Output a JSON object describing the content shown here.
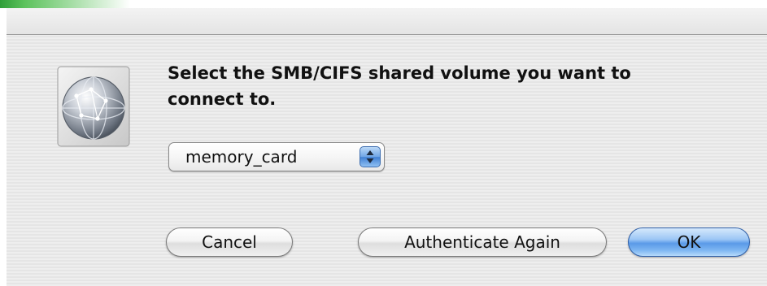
{
  "dialog": {
    "message": "Select the SMB/CIFS shared volume you want to connect to.",
    "app_icon": "network-globe-icon"
  },
  "volume_select": {
    "selected": "memory_card",
    "arrows_icon": "updown-arrows-icon"
  },
  "buttons": {
    "cancel": "Cancel",
    "authenticate": "Authenticate Again",
    "ok": "OK"
  },
  "colors": {
    "default_button": "#6fa6e6",
    "window_background": "#ebebeb",
    "top_strip_accent": "#2e9e38"
  }
}
